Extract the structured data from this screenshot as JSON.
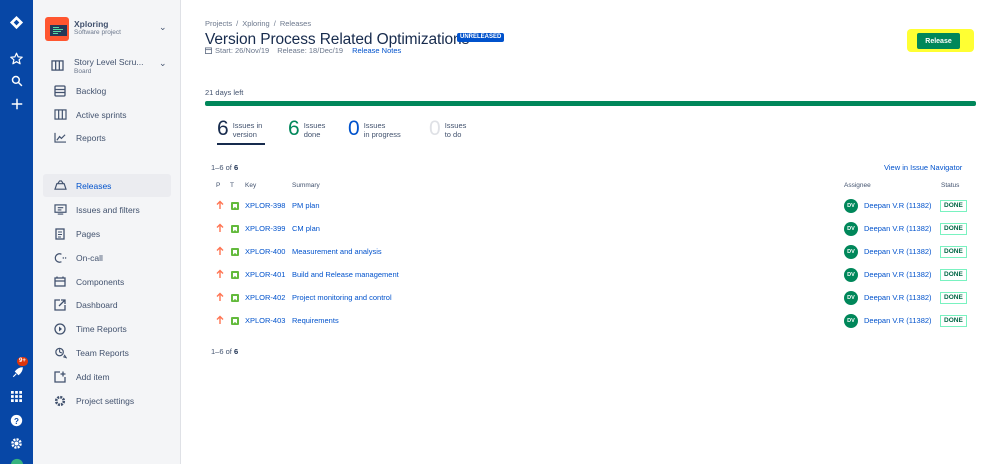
{
  "global_nav": {
    "notifications_badge": "9+"
  },
  "sidebar": {
    "project": {
      "name": "Xploring",
      "type": "Software project"
    },
    "board": {
      "name": "Story Level Scru...",
      "type": "Board"
    },
    "items": [
      {
        "label": "Backlog",
        "icon": "backlog-icon"
      },
      {
        "label": "Active sprints",
        "icon": "active-sprints-icon"
      },
      {
        "label": "Reports",
        "icon": "reports-icon"
      },
      {
        "label": "Releases",
        "icon": "releases-icon"
      },
      {
        "label": "Issues and filters",
        "icon": "issues-icon"
      },
      {
        "label": "Pages",
        "icon": "pages-icon"
      },
      {
        "label": "On-call",
        "icon": "on-call-icon"
      },
      {
        "label": "Components",
        "icon": "components-icon"
      },
      {
        "label": "Dashboard",
        "icon": "dashboard-icon"
      },
      {
        "label": "Time Reports",
        "icon": "time-reports-icon"
      },
      {
        "label": "Team Reports",
        "icon": "team-reports-icon"
      },
      {
        "label": "Add item",
        "icon": "add-item-icon"
      },
      {
        "label": "Project settings",
        "icon": "settings-icon"
      }
    ]
  },
  "breadcrumb": [
    "Projects",
    "/",
    "Xploring",
    "/",
    "Releases"
  ],
  "version": {
    "title": "Version Process Related Optimizations",
    "status": "UNRELEASED",
    "start": "Start: 26/Nov/19",
    "release": "Release: 18/Dec/19",
    "release_notes": "Release Notes"
  },
  "release_button": "Release",
  "progress": {
    "days_left": "21 days left",
    "done_fraction": 1.0
  },
  "stats": [
    {
      "num": "6",
      "line1": "Issues in",
      "line2": "version"
    },
    {
      "num": "6",
      "line1": "Issues",
      "line2": "done"
    },
    {
      "num": "0",
      "line1": "Issues",
      "line2": "in progress"
    },
    {
      "num": "0",
      "line1": "Issues",
      "line2": "to do"
    }
  ],
  "colors": {
    "done": "#00875A",
    "in_progress": "#0052CC",
    "to_do": "#DFE1E6",
    "accent": "#0052CC"
  },
  "table": {
    "count_prefix": "1–6 of",
    "count_total": "6",
    "view_in_navigator": "View in Issue Navigator",
    "headers": {
      "p": "P",
      "t": "T",
      "key": "Key",
      "summary": "Summary",
      "assignee": "Assignee",
      "status": "Status"
    },
    "rows": [
      {
        "key": "XPLOR-398",
        "summary": "PM plan",
        "assignee_initials": "DV",
        "assignee": "Deepan V.R (11382)",
        "status": "DONE"
      },
      {
        "key": "XPLOR-399",
        "summary": "CM plan",
        "assignee_initials": "DV",
        "assignee": "Deepan V.R (11382)",
        "status": "DONE"
      },
      {
        "key": "XPLOR-400",
        "summary": "Measurement and analysis",
        "assignee_initials": "DV",
        "assignee": "Deepan V.R (11382)",
        "status": "DONE"
      },
      {
        "key": "XPLOR-401",
        "summary": "Build and Release management",
        "assignee_initials": "DV",
        "assignee": "Deepan V.R (11382)",
        "status": "DONE"
      },
      {
        "key": "XPLOR-402",
        "summary": "Project monitoring and control",
        "assignee_initials": "DV",
        "assignee": "Deepan V.R (11382)",
        "status": "DONE"
      },
      {
        "key": "XPLOR-403",
        "summary": "Requirements",
        "assignee_initials": "DV",
        "assignee": "Deepan V.R (11382)",
        "status": "DONE"
      }
    ]
  }
}
